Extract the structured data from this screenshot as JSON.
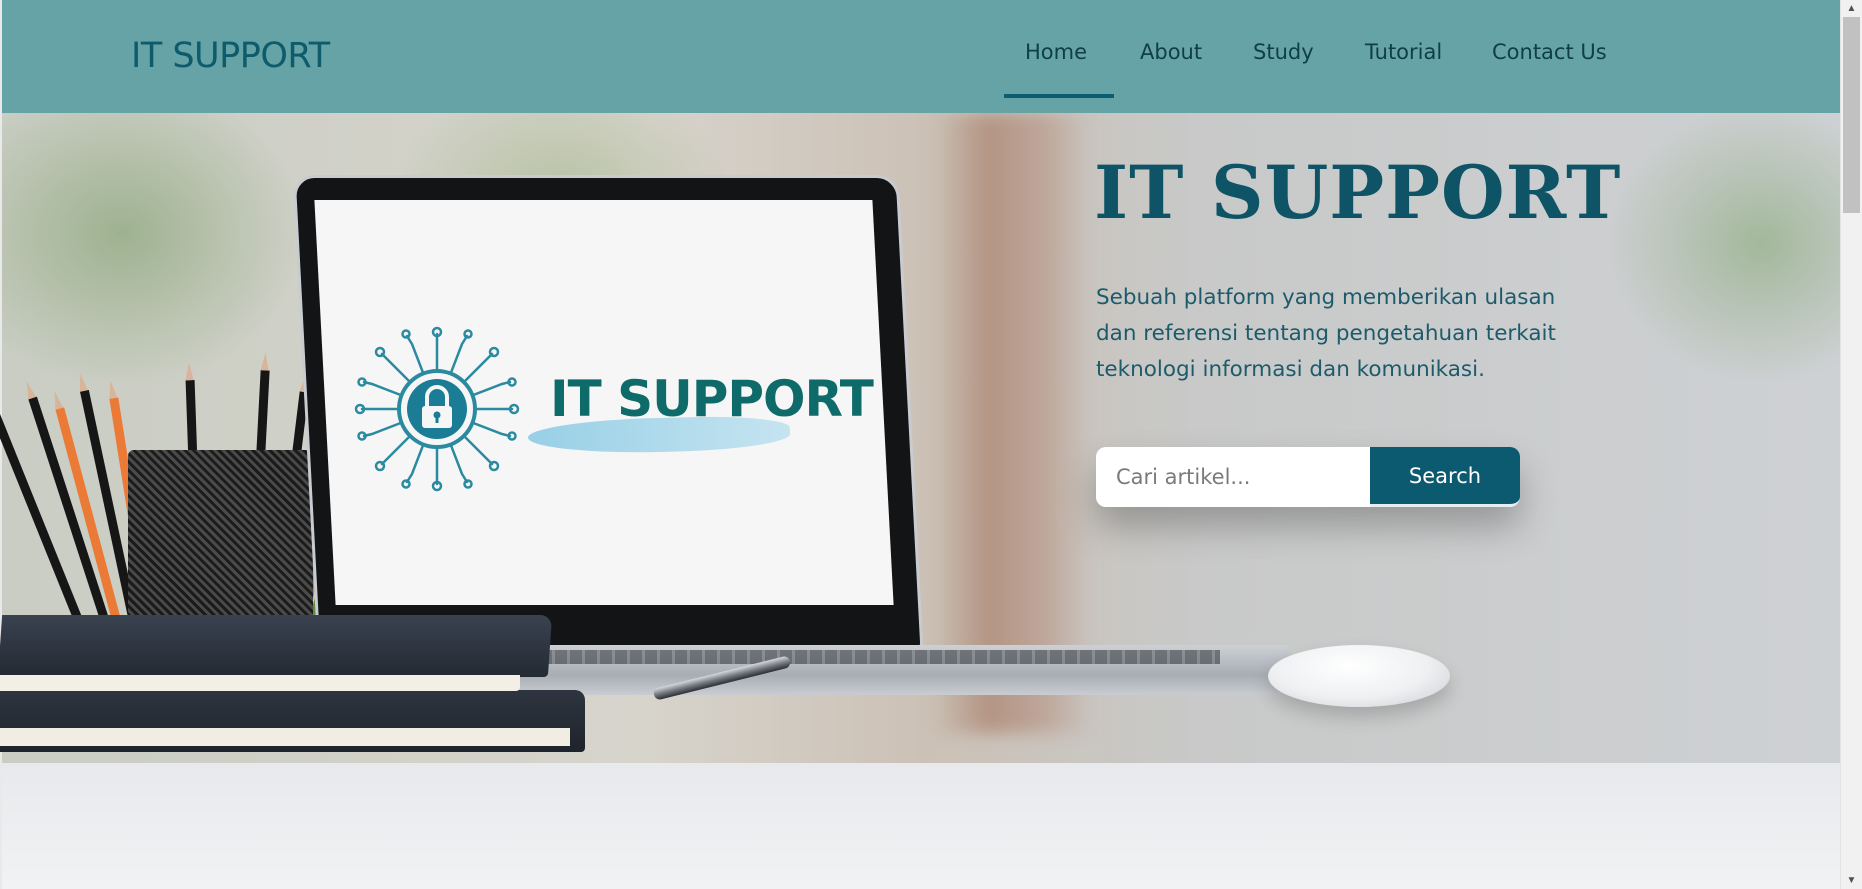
{
  "header": {
    "brand": "IT SUPPORT",
    "nav": [
      {
        "label": "Home",
        "active": true
      },
      {
        "label": "About",
        "active": false
      },
      {
        "label": "Study",
        "active": false
      },
      {
        "label": "Tutorial",
        "active": false
      },
      {
        "label": "Contact Us",
        "active": false
      }
    ]
  },
  "hero": {
    "title": "IT SUPPORT",
    "description": "Sebuah platform yang memberikan ulasan dan referensi tentang pengetahuan terkait teknologi informasi dan komunikasi.",
    "search": {
      "placeholder": "Cari artikel...",
      "value": "",
      "button_label": "Search"
    },
    "laptop_screen_logo_text": "IT SUPPORT"
  },
  "colors": {
    "navbar_bg": "#66a3a6",
    "brand_text": "#0e5b6b",
    "nav_text": "#0f3e49",
    "active_underline": "#0b5e72",
    "hero_title": "#0e5466",
    "search_button_bg": "#0b5a70"
  },
  "icons": {
    "scroll_up": "scroll-up-arrow-icon",
    "scroll_down": "scroll-down-arrow-icon",
    "logo_emblem": "lock-circuit-icon"
  }
}
